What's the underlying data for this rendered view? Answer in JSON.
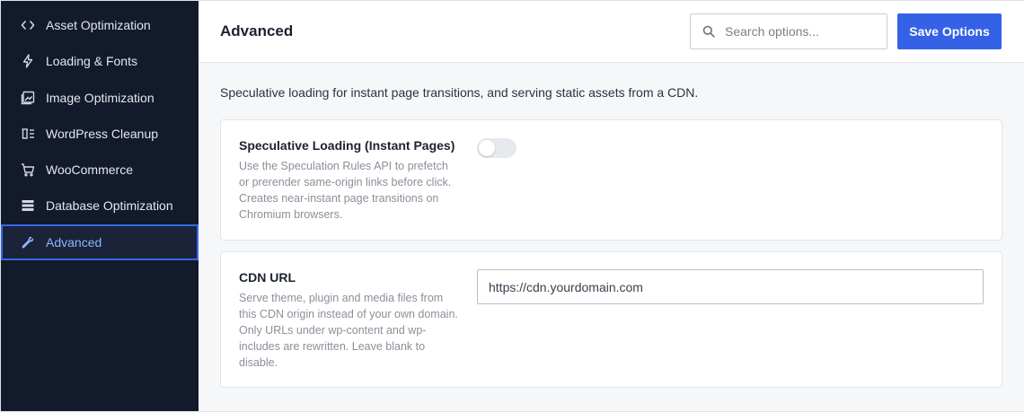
{
  "sidebar": {
    "items": [
      {
        "label": "Asset Optimization",
        "icon": "code-icon"
      },
      {
        "label": "Loading & Fonts",
        "icon": "lightning-icon"
      },
      {
        "label": "Image Optimization",
        "icon": "image-icon"
      },
      {
        "label": "WordPress Cleanup",
        "icon": "cleanup-icon"
      },
      {
        "label": "WooCommerce",
        "icon": "cart-icon"
      },
      {
        "label": "Database Optimization",
        "icon": "database-icon"
      },
      {
        "label": "Advanced",
        "icon": "wrench-icon",
        "active": true
      }
    ]
  },
  "header": {
    "title": "Advanced",
    "search_placeholder": "Search options...",
    "save_label": "Save Options"
  },
  "main": {
    "description": "Speculative loading for instant page transitions, and serving static assets from a CDN.",
    "speculative": {
      "label": "Speculative Loading (Instant Pages)",
      "help": "Use the Speculation Rules API to prefetch or prerender same-origin links before click. Creates near-instant page transitions on Chromium browsers.",
      "enabled": false
    },
    "cdn": {
      "label": "CDN URL",
      "help": "Serve theme, plugin and media files from this CDN origin instead of your own domain. Only URLs under wp-content and wp-includes are rewritten. Leave blank to disable.",
      "placeholder": "https://cdn.yourdomain.com",
      "value": ""
    }
  },
  "colors": {
    "sidebar_bg": "#121a2b",
    "accent": "#3561e6",
    "active_text": "#8fb4ff"
  }
}
